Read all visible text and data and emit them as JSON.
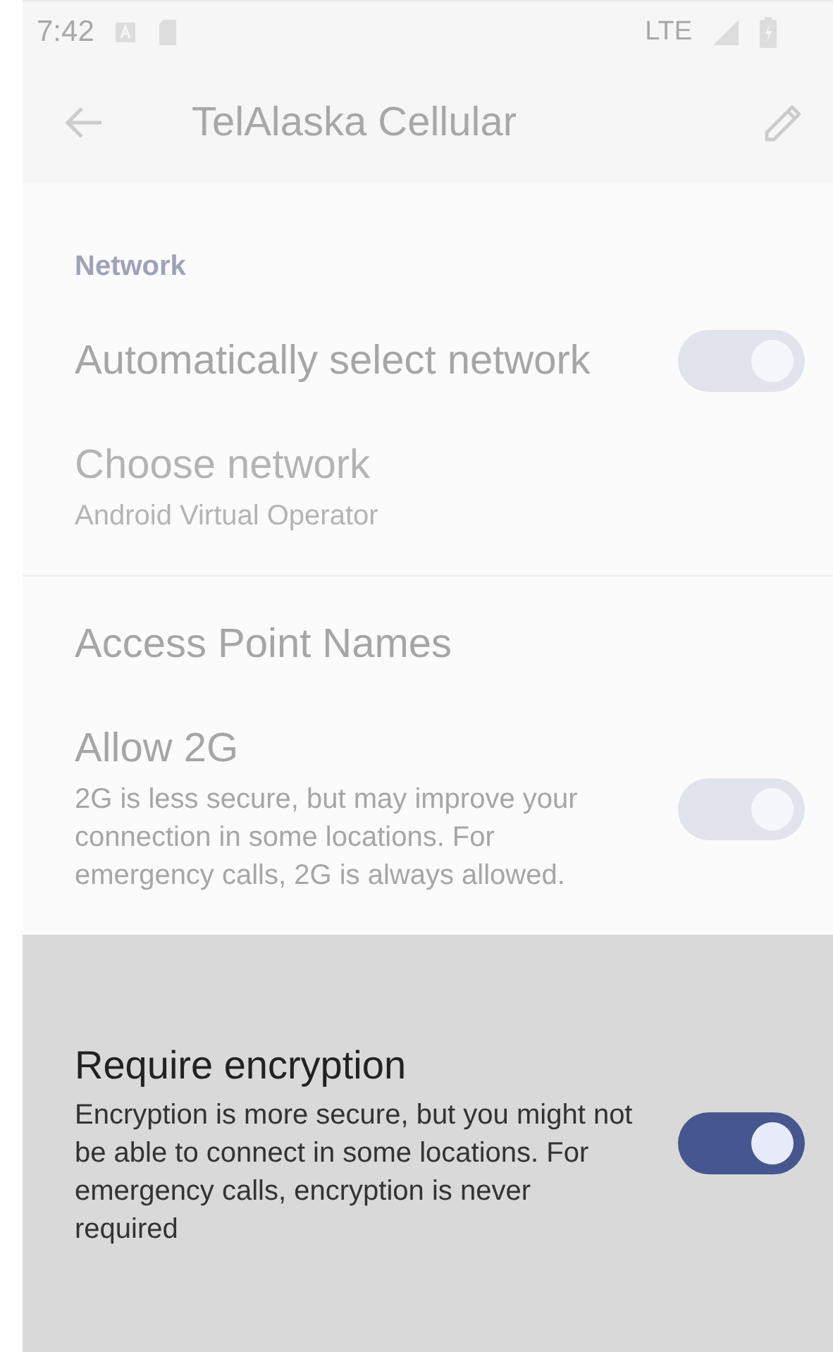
{
  "status_bar": {
    "time": "7:42",
    "network": "LTE"
  },
  "toolbar": {
    "title": "TelAlaska Cellular"
  },
  "section": {
    "title": "Network"
  },
  "settings": [
    {
      "kind": "switch",
      "title": "Automatically select network",
      "on": true,
      "disabled": false,
      "highlighted": false
    },
    {
      "kind": "text",
      "title": "Choose network",
      "summary": "Android Virtual Operator",
      "disabled": true,
      "highlighted": false
    },
    {
      "kind": "divider"
    },
    {
      "kind": "text",
      "title": "Access Point Names",
      "disabled": false,
      "highlighted": false
    },
    {
      "kind": "switch",
      "title": "Allow 2G",
      "summary": "2G is less secure, but may improve your connection in some locations. For emergency calls, 2G is always allowed.",
      "on": true,
      "disabled": false,
      "highlighted": false
    },
    {
      "kind": "switch",
      "title": "Require encryption",
      "summary": "Encryption is more secure, but you might not be able to connect in some locations. For emergency calls, encryption is never required",
      "on": true,
      "disabled": false,
      "highlighted": true
    }
  ]
}
